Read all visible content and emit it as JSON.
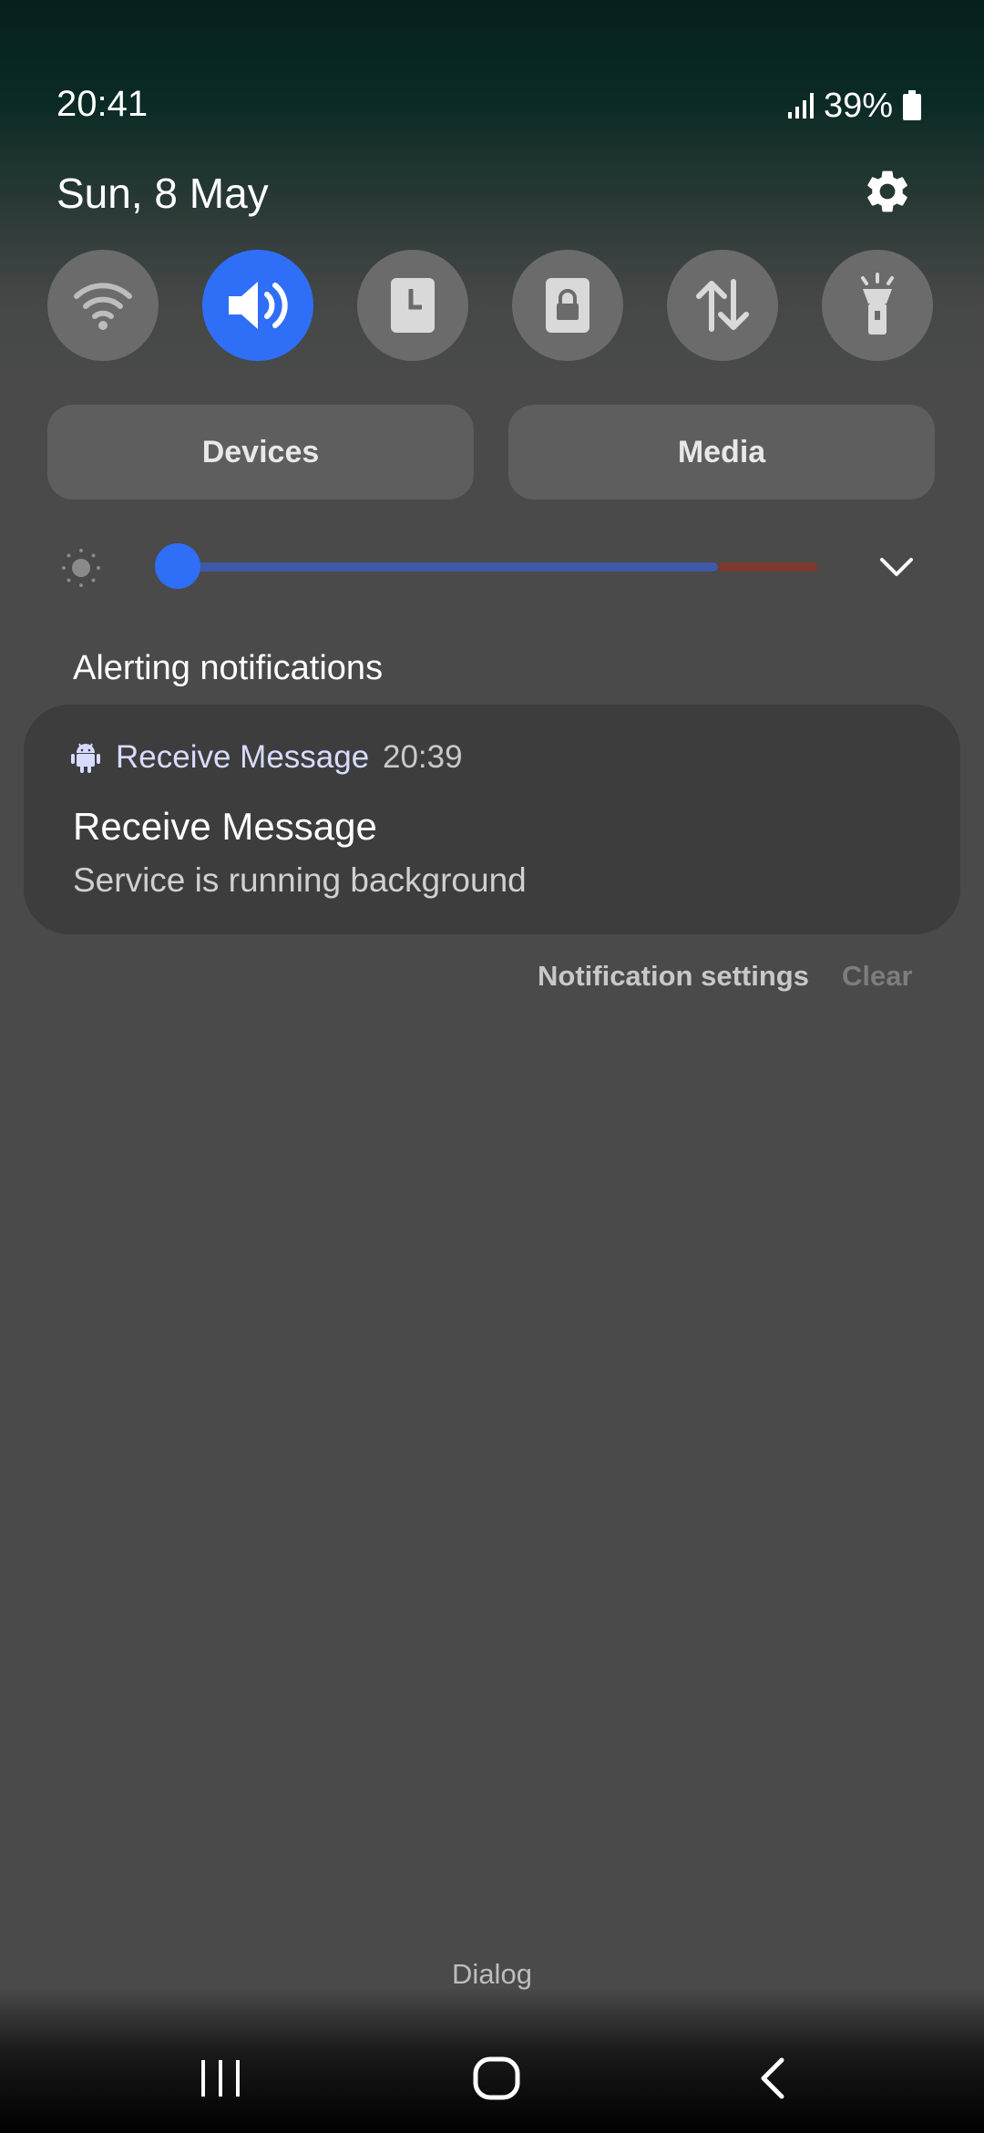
{
  "status_bar": {
    "time": "20:41",
    "battery_percent": "39%",
    "icons": [
      "signal-icon",
      "battery-icon"
    ]
  },
  "shade": {
    "date": "Sun, 8 May",
    "settings_icon": "gear-icon"
  },
  "quick_settings": [
    {
      "name": "wifi",
      "icon": "wifi-icon",
      "active": false
    },
    {
      "name": "sound",
      "icon": "volume-icon",
      "active": true
    },
    {
      "name": "screen-timeout",
      "icon": "clock-icon",
      "active": false
    },
    {
      "name": "screen-lock",
      "icon": "lock-icon",
      "active": false
    },
    {
      "name": "mobile-data",
      "icon": "data-transfer-icon",
      "active": false
    },
    {
      "name": "flashlight",
      "icon": "flashlight-icon",
      "active": false
    }
  ],
  "buttons": {
    "devices": "Devices",
    "media": "Media"
  },
  "brightness": {
    "level": 0.0
  },
  "notifications": {
    "section_title": "Alerting notifications",
    "items": [
      {
        "app_name": "Receive Message",
        "time": "20:39",
        "title": "Receive Message",
        "text": "Service is running background"
      }
    ],
    "settings_label": "Notification settings",
    "clear_label": "Clear"
  },
  "footer_label": "Dialog",
  "nav_bar": [
    "recents-icon",
    "home-icon",
    "back-icon"
  ],
  "colors": {
    "accent": "#2f6ff7",
    "tile_inactive": "#6b6b6b",
    "card": "#3d3d3d",
    "background": "#4a4a4a"
  }
}
